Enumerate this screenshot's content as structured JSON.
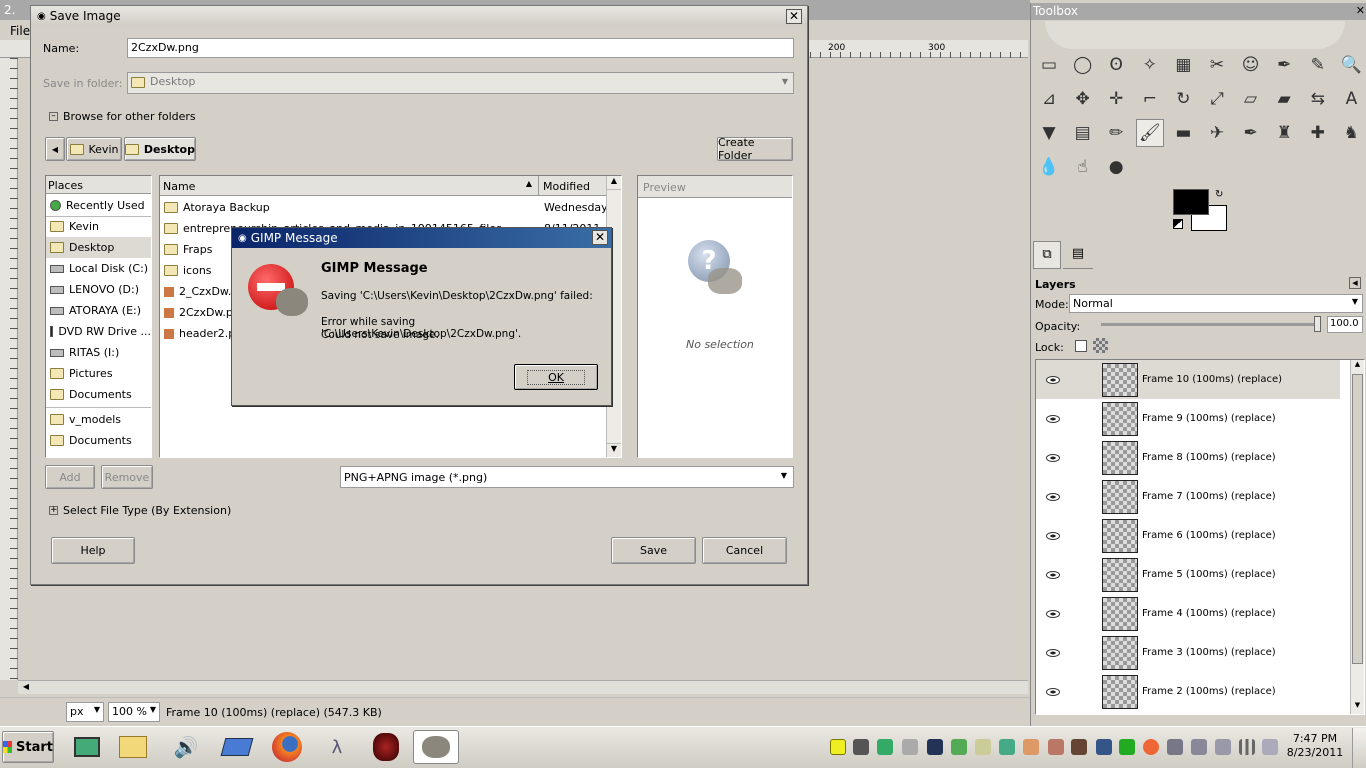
{
  "gimp_window": {
    "title_prefix": "2.",
    "menu_file": "File",
    "ruler_marks": [
      "200",
      "300"
    ],
    "status": {
      "unit": "px",
      "zoom": "100 %",
      "info": "Frame 10 (100ms) (replace) (547.3 KB)"
    }
  },
  "save_dialog": {
    "title": "Save Image",
    "name_label": "Name:",
    "name_value": "2CzxDw.png",
    "folder_label": "Save in folder:",
    "folder_value": "Desktop",
    "browse_label": "Browse for other folders",
    "path_buttons": [
      "Kevin",
      "Desktop"
    ],
    "create_folder": "Create Folder",
    "places_header": "Places",
    "places": [
      {
        "label": "Recently Used",
        "icon": "recent-icon"
      },
      {
        "label": "Kevin",
        "icon": "folder-icon"
      },
      {
        "label": "Desktop",
        "icon": "folder-icon"
      },
      {
        "label": "Local Disk (C:)",
        "icon": "drive-icon"
      },
      {
        "label": "LENOVO (D:)",
        "icon": "drive-icon"
      },
      {
        "label": "ATORAYA (E:)",
        "icon": "drive-icon"
      },
      {
        "label": "DVD RW Drive ...",
        "icon": "dvd-icon"
      },
      {
        "label": "RITAS (I:)",
        "icon": "drive-icon"
      },
      {
        "label": "Pictures",
        "icon": "folder-icon"
      },
      {
        "label": "Documents",
        "icon": "folder-icon"
      },
      {
        "label": "v_models",
        "icon": "folder-icon"
      },
      {
        "label": "Documents",
        "icon": "folder-icon"
      }
    ],
    "file_headers": {
      "name": "Name",
      "modified": "Modified"
    },
    "files": [
      {
        "name": "Atoraya Backup",
        "modified": "Wednesday",
        "icon": "folder-icon"
      },
      {
        "name": "entrepreneurship_articles_and_media_in_199145165_files",
        "modified": "8/11/2011",
        "icon": "folder-icon"
      },
      {
        "name": "Fraps",
        "modified": "",
        "icon": "folder-icon"
      },
      {
        "name": "icons",
        "modified": "",
        "icon": "folder-icon"
      },
      {
        "name": "2_CzxDw.png",
        "modified": "",
        "icon": "image-icon"
      },
      {
        "name": "2CzxDw.png",
        "modified": "",
        "icon": "image-icon"
      },
      {
        "name": "header2.png",
        "modified": "",
        "icon": "image-icon"
      }
    ],
    "preview_label": "Preview",
    "no_selection": "No selection",
    "add": "Add",
    "remove": "Remove",
    "file_type": "PNG+APNG image (*.png)",
    "select_type": "Select File Type (By Extension)",
    "help": "Help",
    "save": "Save",
    "cancel": "Cancel"
  },
  "message": {
    "title": "GIMP Message",
    "heading": "GIMP Message",
    "line1": "Saving 'C:\\Users\\Kevin\\Desktop\\2CzxDw.png' failed:",
    "line2": "Error while saving 'C:\\Users\\Kevin\\Desktop\\2CzxDw.png'.",
    "line3": "Could not save image.",
    "ok": "OK"
  },
  "toolbox": {
    "title": "Toolbox",
    "tools": [
      "rect-select-icon",
      "ellipse-select-icon",
      "lasso-icon",
      "fuzzy-select-icon",
      "color-select-icon",
      "scissors-icon",
      "foreground-select-icon",
      "paths-icon",
      "color-picker-icon",
      "zoom-icon",
      "measure-icon",
      "move-icon",
      "align-icon",
      "crop-icon",
      "rotate-icon",
      "scale-icon",
      "shear-icon",
      "perspective-icon",
      "flip-icon",
      "text-icon",
      "bucket-fill-icon",
      "gradient-icon",
      "pencil-icon",
      "paintbrush-icon",
      "eraser-icon",
      "airbrush-icon",
      "ink-icon",
      "clone-icon",
      "heal-icon",
      "perspective-clone-icon",
      "blur-icon",
      "smudge-icon",
      "dodge-burn-icon"
    ],
    "glyphs": [
      "▭",
      "◯",
      "ʘ",
      "✧",
      "▦",
      "✂",
      "☺",
      "✒",
      "✎",
      "🔍",
      "⊿",
      "✥",
      "✛",
      "⌐",
      "↻",
      "⤢",
      "▱",
      "▰",
      "⇆",
      "A",
      "▼",
      "▤",
      "✏",
      "🖌",
      "▬",
      "✈",
      "✒",
      "♜",
      "✚",
      "♞",
      "💧",
      "☝",
      "●"
    ]
  },
  "layers": {
    "title": "Layers",
    "mode_label": "Mode:",
    "mode_value": "Normal",
    "opacity_label": "Opacity:",
    "opacity_value": "100.0",
    "opacity_fraction": 1.0,
    "lock_label": "Lock:",
    "items": [
      "Frame 10 (100ms) (replace)",
      "Frame 9 (100ms) (replace)",
      "Frame 8 (100ms) (replace)",
      "Frame 7 (100ms) (replace)",
      "Frame 6 (100ms) (replace)",
      "Frame 5 (100ms) (replace)",
      "Frame 4 (100ms) (replace)",
      "Frame 3 (100ms) (replace)",
      "Frame 2 (100ms) (replace)"
    ]
  },
  "taskbar": {
    "start": "Start",
    "time": "7:47 PM",
    "date": "8/23/2011"
  }
}
